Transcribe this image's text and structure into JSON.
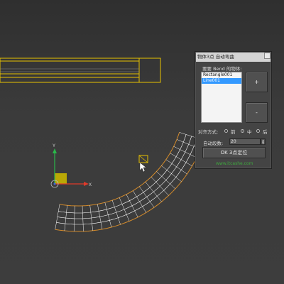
{
  "dialog": {
    "title": "物体3点 自动弯曲",
    "bend_label": "要要 Bend 的物体:",
    "list_items": [
      "Rectangle001",
      "Line001"
    ],
    "selected_item": "Line001",
    "add_label": "+",
    "remove_label": "-",
    "align_label": "对齐方式:",
    "align_options": [
      "前",
      "中",
      "后"
    ],
    "align_selected": "中",
    "segments_label": "自动段数:",
    "segments_value": "20",
    "ok_label": "OK 3点定位",
    "website": "www.itcashe.com"
  },
  "colors": {
    "selection": "#e8c200",
    "bend_wire": "#ffffff",
    "bend_edge": "#d38a2a",
    "gizmo_x": "#e03a2a",
    "gizmo_y": "#2ab84a",
    "gizmo_z": "#3a6ad8",
    "link": "#3ea83e"
  }
}
